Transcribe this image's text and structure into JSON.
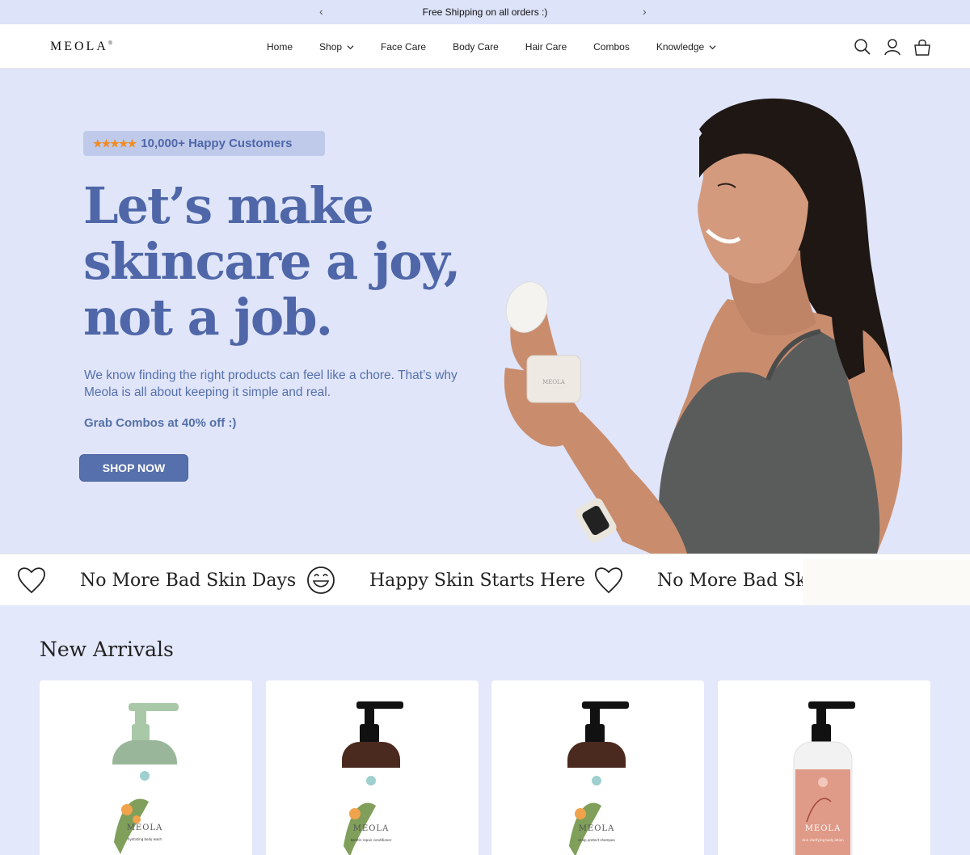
{
  "announcement": {
    "text": "Free Shipping on all orders :)",
    "prev_icon": "chevron-left-icon",
    "next_icon": "chevron-right-icon"
  },
  "header": {
    "logo": "MEOLA",
    "logo_mark": "®",
    "nav": [
      {
        "label": "Home",
        "has_dropdown": false
      },
      {
        "label": "Shop",
        "has_dropdown": true
      },
      {
        "label": "Face Care",
        "has_dropdown": false
      },
      {
        "label": "Body Care",
        "has_dropdown": false
      },
      {
        "label": "Hair Care",
        "has_dropdown": false
      },
      {
        "label": "Combos",
        "has_dropdown": false
      },
      {
        "label": "Knowledge",
        "has_dropdown": true
      }
    ],
    "icons": [
      "search-icon",
      "account-icon",
      "cart-icon"
    ]
  },
  "hero": {
    "stars": "★★★★★",
    "badge_text": "10,000+ Happy Customers",
    "headline_lines": [
      "Let’s make",
      "skincare a joy,",
      "not a job."
    ],
    "subtext_lines": [
      "We know finding the right products can feel like a chore.  That’s why",
      "Meola is all about keeping it simple and real."
    ],
    "promo": "Grab Combos at 40% off :)",
    "cta": "SHOP NOW",
    "jar_label": "MEOLA",
    "colors": {
      "accent": "#4f67a8",
      "button": "#5670ad",
      "star": "#f08c21",
      "background": "#e0e5f9"
    }
  },
  "marquee": {
    "items": [
      {
        "icon": "heart-icon",
        "text": "No More Bad Skin Days"
      },
      {
        "icon": "smiley-icon",
        "text": "Happy Skin Starts Here"
      },
      {
        "icon": "heart-icon",
        "text": "No More Bad Skir"
      }
    ]
  },
  "new_arrivals": {
    "title": "New Arrivals",
    "products": [
      {
        "brand": "MEOLA",
        "bottle_color": "#9ab69a",
        "pump_color": "#a9c8a8",
        "label_color": "#ffffff",
        "name": "hydrating body wash"
      },
      {
        "brand": "MEOLA",
        "bottle_color": "#4a2a1e",
        "pump_color": "#111111",
        "label_color": "#ffffff",
        "name": "keratin repair conditioner"
      },
      {
        "brand": "MEOLA",
        "bottle_color": "#4a2a1e",
        "pump_color": "#111111",
        "label_color": "#ffffff",
        "name": "scalp protect shampoo"
      },
      {
        "brand": "MEOLA",
        "bottle_color": "#f2f2f2",
        "pump_color": "#111111",
        "label_color": "#e09a88",
        "name": "skin clarifying body lotion"
      }
    ]
  }
}
